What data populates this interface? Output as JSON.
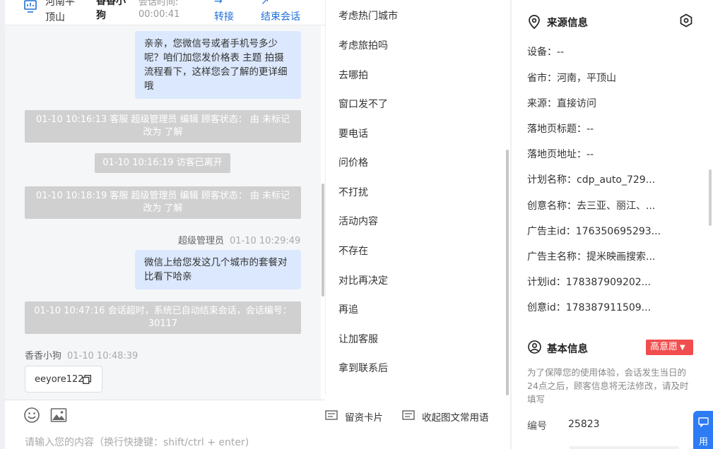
{
  "chat_header": {
    "location": "河南平顶山",
    "name": "香香小狗",
    "time_label": "会话时间:",
    "duration": "00:00:41",
    "transfer_label": "转接",
    "end_label": "结束会话"
  },
  "messages": {
    "m1": "亲亲，您微信号或者手机号多少呢？咱们加您发价格表 主题 拍摄流程看下，这样您会了解的更详细哦",
    "s1": "01-10 10:16:13 客服 超级管理员 编辑 顾客状态： 由 未标记 改为 了解",
    "s2": "01-10 10:16:19 访客已离开",
    "s3": "01-10 10:18:19 客服 超级管理员 编辑 顾客状态： 由 未标记 改为 了解",
    "agent_sender": "超级管理员",
    "agent_time": "01-10 10:29:49",
    "m2": "微信上给您发这几个城市的套餐对比看下哈亲",
    "s4": "01-10 10:47:16 会话超时，系统已自动结束会话，会话编号：30117",
    "visitor_sender": "香香小狗",
    "visitor_time": "01-10 10:48:39",
    "card_text": "eeyore122"
  },
  "toolbar": {
    "emoji_icon": "smiley-icon",
    "image_icon": "image-icon",
    "lead_card_label": "留资卡片",
    "collapse_label": "收起图文常用语"
  },
  "input": {
    "placeholder": "请输入您的内容（换行快捷键：shift/ctrl + enter)"
  },
  "phrases": [
    "考虑热门城市",
    "考虑旅拍吗",
    "去哪拍",
    "窗口发不了",
    "要电话",
    "问价格",
    "不打扰",
    "活动内容",
    "不存在",
    "对比再决定",
    "再追",
    "让加客服",
    "拿到联系后"
  ],
  "source_info": {
    "title": "来源信息",
    "rows": [
      "设备：--",
      "省市：河南，平顶山",
      "来源：直接访问",
      "落地页标题：--",
      "落地页地址：--",
      "计划名称：cdp_auto_729...",
      "创意名称：去三亚、丽江、...",
      "广告主id：176350695293...",
      "广告主名称：提米映画搜索...",
      "计划id：178387909202...",
      "创意id：178387911509..."
    ]
  },
  "basic_info": {
    "title": "基本信息",
    "intention": "高意愿",
    "note": "为了保障您的使用体验，会话发生当日的24点之后，顾客信息将无法修改，请及时填写",
    "id_label": "编号",
    "id_value": "25823"
  },
  "float_button": {
    "label": "用"
  },
  "colors": {
    "accent": "#1e6fd9",
    "bubble": "#dbe8fd",
    "badge": "#f04e4e",
    "float": "#2d7cf6"
  }
}
